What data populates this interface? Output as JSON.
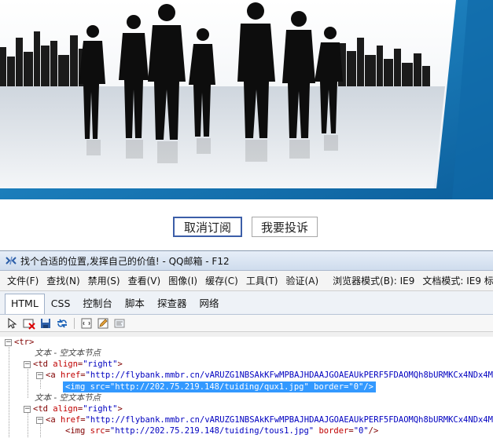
{
  "banner": {
    "colors": {
      "sky": "#f4f7fb",
      "frame_blue": "#1b85c8",
      "silhouette": "#111111"
    }
  },
  "buttons": {
    "unsubscribe": "取消订阅",
    "complain": "我要投诉"
  },
  "devtools": {
    "title": "找个合适的位置,发挥自己的价值! - QQ邮箱 - F12",
    "menu": [
      "文件(F)",
      "查找(N)",
      "禁用(S)",
      "查看(V)",
      "图像(I)",
      "缓存(C)",
      "工具(T)",
      "验证(A)",
      "浏览器模式(B): IE9",
      "文档模式: IE9 标"
    ],
    "tabs": [
      "HTML",
      "CSS",
      "控制台",
      "脚本",
      "探查器",
      "网络"
    ],
    "toolbar_icons": [
      "select-element-icon",
      "clear-highlight-icon",
      "save-icon",
      "refresh-icon",
      "word-wrap-icon",
      "edit-icon",
      "dom-page-icon"
    ],
    "tree": {
      "tr_open": "<tr>",
      "text_node_1": "文本 - 空文本节点",
      "td1_tag": "<td",
      "td1_attr": "align",
      "td1_val": "\"right\"",
      "a1_tag": "<a",
      "a1_attr": "href",
      "a1_val": "\"http://flybank.mmbr.cn/vARUZG1NBSAkKFwMPBAJHDAAJGOAEAUkPERF5FDAOMQh8bURMKCx4NDx4MNggJV.",
      "img1_tag": "<img",
      "img1_src_attr": "src",
      "img1_src_val": "\"http://202.75.219.148/tuiding/qux1.jpg\"",
      "img1_border_attr": "border",
      "img1_border_val": "\"0\"",
      "img1_close": "/>",
      "text_node_2": "文本 - 空文本节点",
      "td2_tag": "<td",
      "td2_attr": "align",
      "td2_val": "\"right\"",
      "a2_tag": "<a",
      "a2_attr": "href",
      "a2_val": "\"http://flybank.mmbr.cn/vARUZG1NBSAkKFwMPBAJHDAAJGOAEAUkPERF5FDAOMQh8bURMKCx4NDx4MNggJV.",
      "img2_tag": "<img",
      "img2_src_attr": "src",
      "img2_src_val": "\"http://202.75.219.148/tuiding/tous1.jpg\"",
      "img2_border_attr": "border",
      "img2_border_val": "\"0\"",
      "img2_close": "/>"
    }
  }
}
